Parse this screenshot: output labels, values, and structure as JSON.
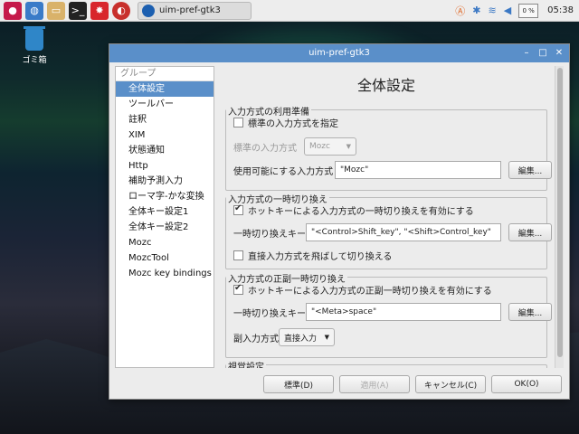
{
  "taskbar": {
    "task_title": "uim-pref-gtk3",
    "tray": {
      "cpu": "0 %",
      "clock": "05:38"
    }
  },
  "desktop": {
    "trash_label": "ゴミ箱"
  },
  "window": {
    "title": "uim-pref-gtk3"
  },
  "sidebar": {
    "header": "グループ",
    "items": [
      "全体設定",
      "ツールバー",
      "註釈",
      "XIM",
      "状態通知",
      "Http",
      "補助予測入力",
      "ローマ字-かな変換",
      "全体キー設定1",
      "全体キー設定2",
      "Mozc",
      "MozcTool",
      "Mozc key bindings"
    ],
    "selected_index": 0
  },
  "content": {
    "title": "全体設定",
    "group1": {
      "legend": "入力方式の利用準備",
      "checkbox_label": "標準の入力方式を指定",
      "checkbox_checked": false,
      "default_label": "標準の入力方式",
      "default_value": "Mozc",
      "enabled_label": "使用可能にする入力方式",
      "enabled_value": "\"Mozc\"",
      "edit_button": "編集..."
    },
    "group2": {
      "legend": "入力方式の一時切り換え",
      "checkbox_label": "ホットキーによる入力方式の一時切り換えを有効にする",
      "checkbox_checked": true,
      "key_label": "一時切り換えキー",
      "key_value": "\"<Control>Shift_key\", \"<Shift>Control_key\"",
      "edit_button": "編集...",
      "skip_label": "直接入力方式を飛ばして切り換える",
      "skip_checked": false
    },
    "group3": {
      "legend": "入力方式の正副一時切り換え",
      "checkbox_label": "ホットキーによる入力方式の正副一時切り換えを有効にする",
      "checkbox_checked": true,
      "key_label": "一時切り換えキー",
      "key_value": "\"<Meta>space\"",
      "edit_button": "編集...",
      "sub_label": "副入力方式",
      "sub_value": "直接入力"
    },
    "group4": {
      "legend": "視覚設定"
    }
  },
  "footer": {
    "default_button": "標準(D)",
    "apply_button": "適用(A)",
    "cancel_button": "キャンセル(C)",
    "ok_button": "OK(O)"
  }
}
